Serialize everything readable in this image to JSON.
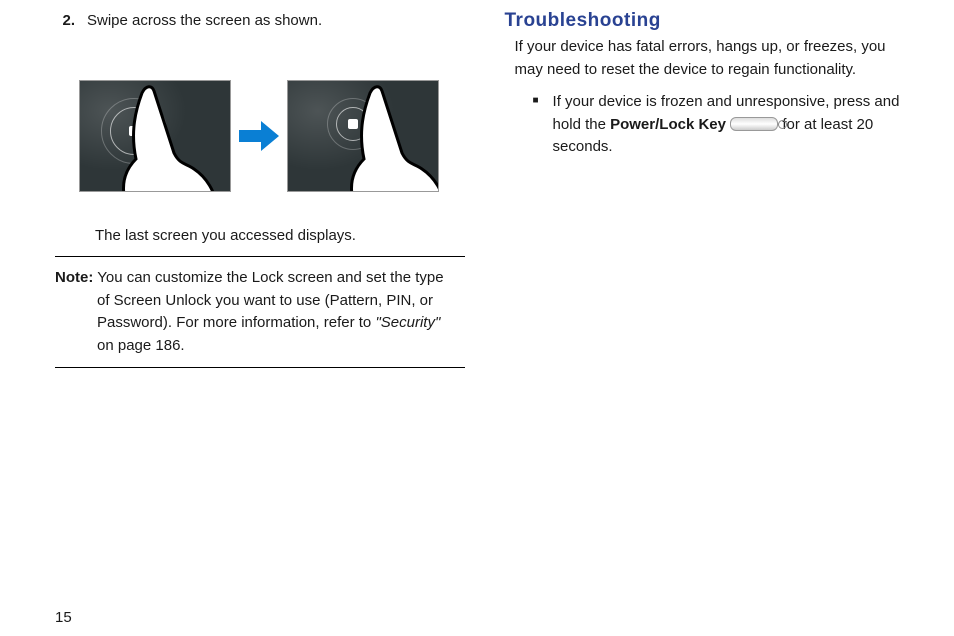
{
  "left": {
    "step": {
      "number": "2.",
      "text": "Swipe across the screen as shown."
    },
    "caption": "The last screen you accessed displays.",
    "note": {
      "label": "Note:",
      "body_before": " You can customize the Lock screen and set the type of Screen Unlock you want to use (Pattern, PIN, or Password). For more information, refer to ",
      "security_label": "\"Security\"",
      "body_after": "  on page 186."
    }
  },
  "right": {
    "heading": "Troubleshooting",
    "intro": "If your device has fatal errors, hangs up, or freezes, you may need to reset the device to regain functionality.",
    "bullet": {
      "pre": "If your device is frozen and unresponsive, press and hold the ",
      "key_label": "Power/Lock Key",
      "post": "  for at least 20 seconds."
    }
  },
  "page_number": "15"
}
